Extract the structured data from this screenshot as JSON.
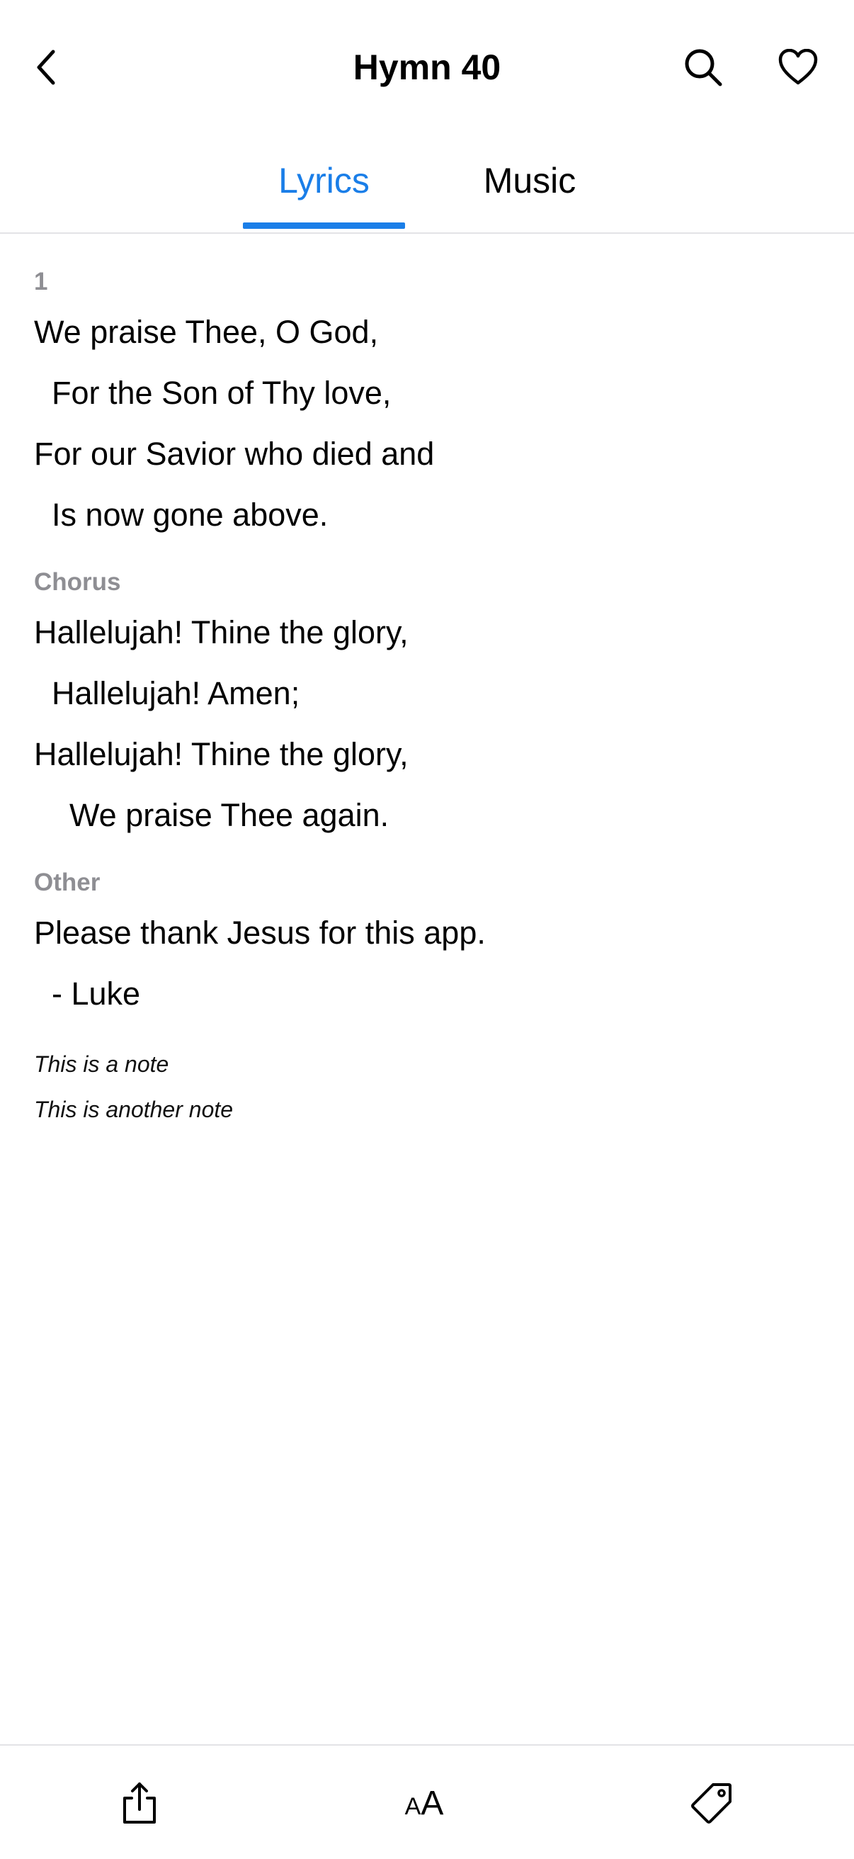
{
  "header": {
    "title": "Hymn 40",
    "icons": {
      "back": "chevron-left-icon",
      "search": "search-icon",
      "favorite": "heart-icon"
    }
  },
  "tabs": [
    {
      "label": "Lyrics",
      "selected": true
    },
    {
      "label": "Music",
      "selected": false
    }
  ],
  "colors": {
    "accent": "#1a7ee8",
    "label_gray": "#8e8e93",
    "divider": "#e3e3e6"
  },
  "sections": [
    {
      "label": "1",
      "lines": [
        "We praise Thee, O God,",
        "  For the Son of Thy love,",
        "For our Savior who died and",
        "  Is now gone above."
      ]
    },
    {
      "label": "Chorus",
      "lines": [
        "Hallelujah! Thine the glory,",
        "  Hallelujah! Amen;",
        "Hallelujah! Thine the glory,",
        "    We praise Thee again."
      ]
    },
    {
      "label": "Other",
      "lines": [
        "Please thank Jesus for this app.",
        "  - Luke"
      ]
    }
  ],
  "notes": [
    "This is a note",
    "This is another note"
  ],
  "bottom_bar": {
    "text_size_label_small": "A",
    "text_size_label_big": "A",
    "icons": {
      "share": "share-icon",
      "text_size": "text-size-icon",
      "tag": "tag-icon"
    }
  }
}
